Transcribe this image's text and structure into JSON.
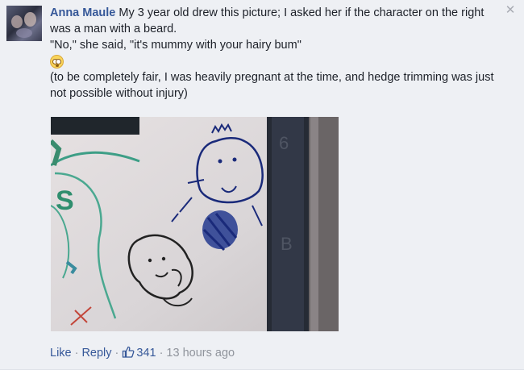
{
  "comment": {
    "author": "Anna Maule",
    "line1": " My 3 year old drew this picture; I asked her if the character on the right was a man with a beard.",
    "line2": "\"No,\" she said, \"it's mummy with your hairy bum\"",
    "line3": "(to be completely fair, I was heavily pregnant at the time, and hedge trimming was just not possible without injury)",
    "emoji": "flushed-face-emoji"
  },
  "photo": {
    "digits": [
      "6",
      "B"
    ]
  },
  "actions": {
    "like_label": "Like",
    "dot1": "·",
    "reply_label": "Reply",
    "dot2": "·",
    "like_count": "341",
    "dot3": "·",
    "timestamp": "13 hours ago"
  },
  "colors": {
    "link": "#365899",
    "meta": "#90949c",
    "background": "#eef0f4"
  },
  "icons": {
    "close": "close-icon",
    "thumb": "thumbs-up-icon"
  }
}
